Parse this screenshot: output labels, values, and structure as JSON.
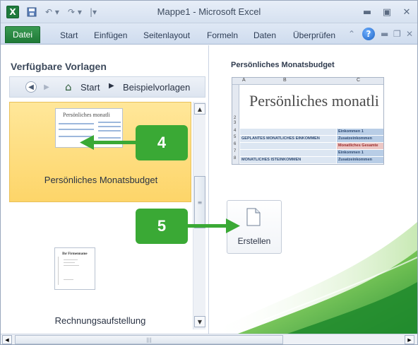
{
  "window": {
    "title": "Mappe1 - Microsoft Excel",
    "app_icon_glyph": "X",
    "controls": [
      "minimize-icon",
      "maximize-icon",
      "close-icon"
    ]
  },
  "ribbon": {
    "tabs": [
      "Datei",
      "Start",
      "Einfügen",
      "Seitenlayout",
      "Formeln",
      "Daten",
      "Überprüfen"
    ],
    "active_tab": "Datei",
    "accent_color": "#2a8a44"
  },
  "left_panel": {
    "heading": "Verfügbare Vorlagen",
    "breadcrumb": {
      "home": "Start",
      "current": "Beispielvorlagen"
    },
    "templates": [
      {
        "label": "Persönliches Monatsbudget",
        "thumb_title": "Persönliches monatli",
        "selected": true
      },
      {
        "label": "Rechnungsaufstellung",
        "thumb_title": "Ihr Firmenname",
        "selected": false
      }
    ],
    "selection_color": "#fde08a"
  },
  "right_panel": {
    "heading": "Persönliches Monatsbudget",
    "preview": {
      "columns": [
        "A",
        "B",
        "C"
      ],
      "title": "Persönliches monatli",
      "row_numbers": [
        "2",
        "3",
        "4",
        "5",
        "6",
        "7",
        "8"
      ],
      "rows": [
        {
          "left": "",
          "right": "Einkommen 1"
        },
        {
          "left": "GEPLANTES MONATLICHES EINKOMMEN",
          "right": "Zusatzeinkommen"
        },
        {
          "left": "",
          "right": "Monatliches Gesamte"
        },
        {
          "left": "",
          "right": "Einkommen 1"
        },
        {
          "left": "MONATLICHES ISTEINKOMMEN",
          "right": "Zusatzeinkommen"
        }
      ]
    },
    "create_button": "Erstellen"
  },
  "callouts": [
    "4",
    "5"
  ],
  "callout_color": "#3aa935"
}
